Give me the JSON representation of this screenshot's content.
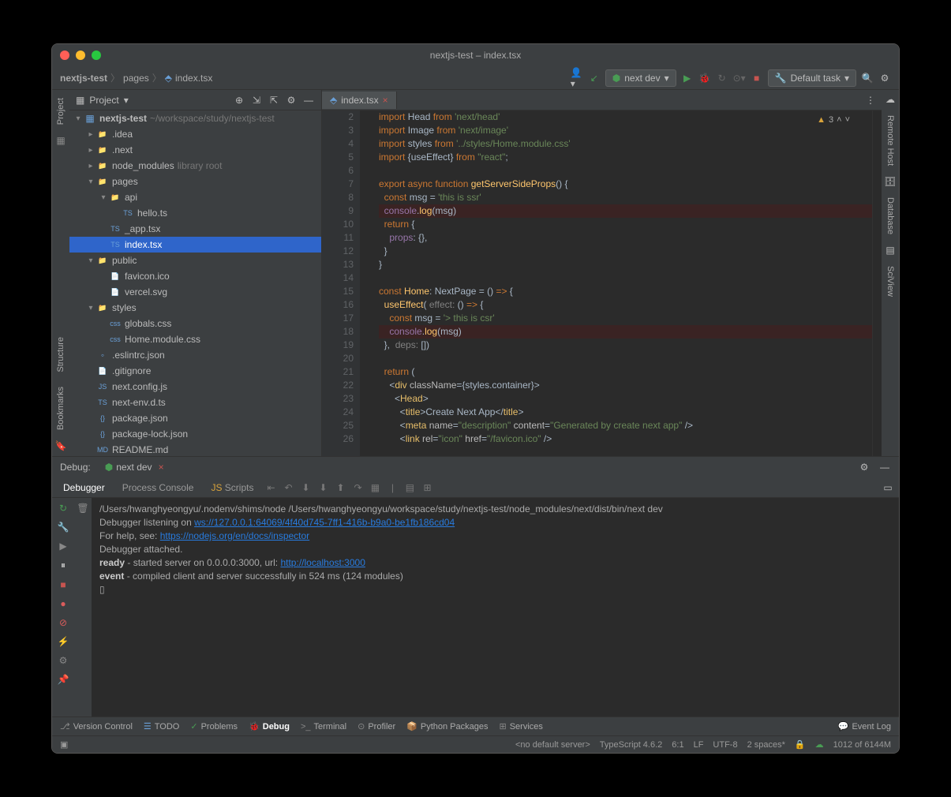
{
  "window": {
    "title": "nextjs-test – index.tsx"
  },
  "breadcrumb": [
    "nextjs-test",
    "pages",
    "index.tsx"
  ],
  "runconfig": {
    "label": "next dev",
    "taskLabel": "Default task"
  },
  "projectPanel": {
    "title": "Project",
    "root": {
      "name": "nextjs-test",
      "path": "~/workspace/study/nextjs-test"
    },
    "items": [
      {
        "indent": 1,
        "arrow": "▸",
        "icon": "📁",
        "name": ".idea"
      },
      {
        "indent": 1,
        "arrow": "▸",
        "icon": "📁",
        "name": ".next",
        "orange": true
      },
      {
        "indent": 1,
        "arrow": "▸",
        "icon": "📁",
        "name": "node_modules",
        "dim": "library root"
      },
      {
        "indent": 1,
        "arrow": "▾",
        "icon": "📁",
        "name": "pages"
      },
      {
        "indent": 2,
        "arrow": "▾",
        "icon": "📁",
        "name": "api"
      },
      {
        "indent": 3,
        "arrow": "",
        "icon": "TS",
        "name": "hello.ts"
      },
      {
        "indent": 2,
        "arrow": "",
        "icon": "TS",
        "name": "_app.tsx"
      },
      {
        "indent": 2,
        "arrow": "",
        "icon": "TS",
        "name": "index.tsx",
        "sel": true
      },
      {
        "indent": 1,
        "arrow": "▾",
        "icon": "📁",
        "name": "public"
      },
      {
        "indent": 2,
        "arrow": "",
        "icon": "📄",
        "name": "favicon.ico"
      },
      {
        "indent": 2,
        "arrow": "",
        "icon": "📄",
        "name": "vercel.svg"
      },
      {
        "indent": 1,
        "arrow": "▾",
        "icon": "📁",
        "name": "styles"
      },
      {
        "indent": 2,
        "arrow": "",
        "icon": "css",
        "name": "globals.css"
      },
      {
        "indent": 2,
        "arrow": "",
        "icon": "css",
        "name": "Home.module.css"
      },
      {
        "indent": 1,
        "arrow": "",
        "icon": "◦",
        "name": ".eslintrc.json"
      },
      {
        "indent": 1,
        "arrow": "",
        "icon": "📄",
        "name": ".gitignore"
      },
      {
        "indent": 1,
        "arrow": "",
        "icon": "JS",
        "name": "next.config.js"
      },
      {
        "indent": 1,
        "arrow": "",
        "icon": "TS",
        "name": "next-env.d.ts"
      },
      {
        "indent": 1,
        "arrow": "",
        "icon": "{}",
        "name": "package.json"
      },
      {
        "indent": 1,
        "arrow": "",
        "icon": "{}",
        "name": "package-lock.json"
      },
      {
        "indent": 1,
        "arrow": "",
        "icon": "MD",
        "name": "README.md"
      }
    ]
  },
  "editor": {
    "tabName": "index.tsx",
    "warnings": "3",
    "lineStart": 2,
    "lines": [
      {
        "n": 2,
        "html": "<span class='kw'>import</span> <span class='ty'>Head</span> <span class='kw'>from</span> <span class='str'>'next/head'</span>"
      },
      {
        "n": 3,
        "html": "<span class='kw'>import</span> <span class='ty'>Image</span> <span class='kw'>from</span> <span class='str'>'next/image'</span>"
      },
      {
        "n": 4,
        "html": "<span class='kw'>import</span> <span class='ty'>styles</span> <span class='kw'>from</span> <span class='str'>'../styles/Home.module.css'</span>"
      },
      {
        "n": 5,
        "html": "<span class='kw'>import</span> {<span class='ty'>useEffect</span>} <span class='kw'>from</span> <span class='str'>\"react\"</span>;"
      },
      {
        "n": 6,
        "html": ""
      },
      {
        "n": 7,
        "html": "<span class='kw'>export async function</span> <span class='fn'>getServerSideProps</span>() {"
      },
      {
        "n": 8,
        "html": "  <span class='kw'>const</span> <span class='ty'>msg</span> = <span class='str'>'this is ssr'</span>"
      },
      {
        "n": 9,
        "bp": true,
        "html": "  <span class='bl'>console</span>.<span class='fn'>log</span>(<span class='ty'>msg</span>)"
      },
      {
        "n": 10,
        "html": "  <span class='kw'>return</span> {"
      },
      {
        "n": 11,
        "html": "    <span class='prop'>props</span>: {},"
      },
      {
        "n": 12,
        "html": "  }"
      },
      {
        "n": 13,
        "html": "}"
      },
      {
        "n": 14,
        "html": ""
      },
      {
        "n": 15,
        "html": "<span class='kw'>const</span> <span class='fn'>Home</span>: <span class='ty'>NextPage</span> = () <span class='kw'>=&gt;</span> {"
      },
      {
        "n": 16,
        "html": "  <span class='fn'>useEffect</span>( <span class='com'>effect:</span> () <span class='kw'>=&gt;</span> {"
      },
      {
        "n": 17,
        "html": "    <span class='kw'>const</span> <span class='ty'>msg</span> = <span class='str'>'&gt; this is csr'</span>"
      },
      {
        "n": 18,
        "bp": true,
        "html": "    <span class='bl'>console</span>.<span class='fn'>log</span>(<span class='ty'>msg</span>)"
      },
      {
        "n": 19,
        "html": "  },  <span class='com'>deps:</span> [])"
      },
      {
        "n": 20,
        "html": ""
      },
      {
        "n": 21,
        "html": "  <span class='kw'>return</span> ("
      },
      {
        "n": 22,
        "html": "    &lt;<span class='tag'>div</span> <span class='attr'>className</span>={<span class='ty'>styles.container</span>}&gt;"
      },
      {
        "n": 23,
        "html": "      &lt;<span class='tag'>Head</span>&gt;"
      },
      {
        "n": 24,
        "html": "        &lt;<span class='tag'>title</span>&gt;Create Next App&lt;/<span class='tag'>title</span>&gt;"
      },
      {
        "n": 25,
        "html": "        &lt;<span class='tag'>meta</span> <span class='attr'>name</span>=<span class='str'>\"description\"</span> <span class='attr'>content</span>=<span class='str'>\"Generated by create next app\"</span> /&gt;"
      },
      {
        "n": 26,
        "html": "        &lt;<span class='tag'>link</span> <span class='attr'>rel</span>=<span class='str'>\"icon\"</span> <span class='attr'>href</span>=<span class='str'>\"/favicon.ico\"</span> /&gt;"
      }
    ]
  },
  "debug": {
    "label": "Debug:",
    "config": "next dev",
    "tabs": [
      "Debugger",
      "Process Console",
      "Scripts"
    ],
    "activeTab": "Debugger",
    "console": [
      {
        "t": "/Users/hwanghyeongyu/.nodenv/shims/node /Users/hwanghyeongyu/workspace/study/nextjs-test/node_modules/next/dist/bin/next dev"
      },
      {
        "t": "Debugger listening on ",
        "link": "ws://127.0.0.1:64069/4f40d745-7ff1-416b-b9a0-be1fb186cd04"
      },
      {
        "t": "For help, see: ",
        "link": "https://nodejs.org/en/docs/inspector"
      },
      {
        "t": "Debugger attached."
      },
      {
        "k": "ready",
        "t": " - started server on 0.0.0.0:3000, url: ",
        "link": "http://localhost:3000"
      },
      {
        "k": "event",
        "t": " - compiled client and server successfully in 524 ms (124 modules)"
      },
      {
        "t": "▯"
      }
    ]
  },
  "leftStrips": [
    "Project"
  ],
  "leftStripsBottom": [
    "Structure",
    "Bookmarks"
  ],
  "rightStrips": [
    "Remote Host",
    "Database",
    "SciView"
  ],
  "bottomBar": [
    "Version Control",
    "TODO",
    "Problems",
    "Debug",
    "Terminal",
    "Profiler",
    "Python Packages",
    "Services"
  ],
  "bottomActive": "Debug",
  "eventLog": "Event Log",
  "status": {
    "noServer": "<no default server>",
    "ts": "TypeScript 4.6.2",
    "pos": "6:1",
    "le": "LF",
    "enc": "UTF-8",
    "indent": "2 spaces*",
    "mem": "1012 of 6144M"
  }
}
